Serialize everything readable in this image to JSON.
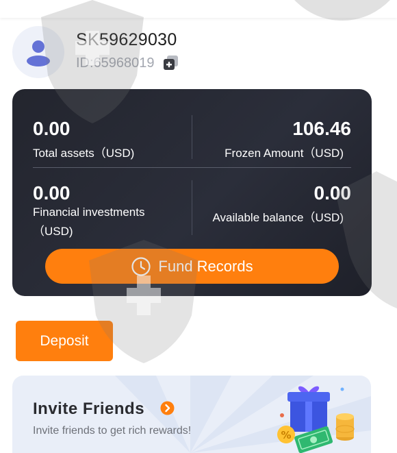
{
  "profile": {
    "username": "SK59629030",
    "user_id": "ID:65968019",
    "avatar_icon": "user-icon",
    "copy_icon": "copy-icon"
  },
  "assets": {
    "total_assets_value": "0.00",
    "total_assets_label": "Total assets（USD)",
    "frozen_value": "106.46",
    "frozen_label": "Frozen Amount（USD)",
    "financial_value": "0.00",
    "financial_label_line1": "Financial investments",
    "financial_label_line2": "（USD)",
    "available_value": "0.00",
    "available_label": "Available balance（USD)"
  },
  "actions": {
    "fund_records_label": "Fund Records",
    "fund_records_icon": "clock-icon",
    "deposit_label": "Deposit"
  },
  "invite": {
    "title": "Invite Friends",
    "subtitle": "Invite friends to get rich rewards!",
    "arrow_icon": "chevron-right-icon",
    "illustration": "gift-money-icon"
  },
  "colors": {
    "accent": "#ff7f0e",
    "card_bg": "#252833",
    "invite_bg": "#e9eef8"
  }
}
